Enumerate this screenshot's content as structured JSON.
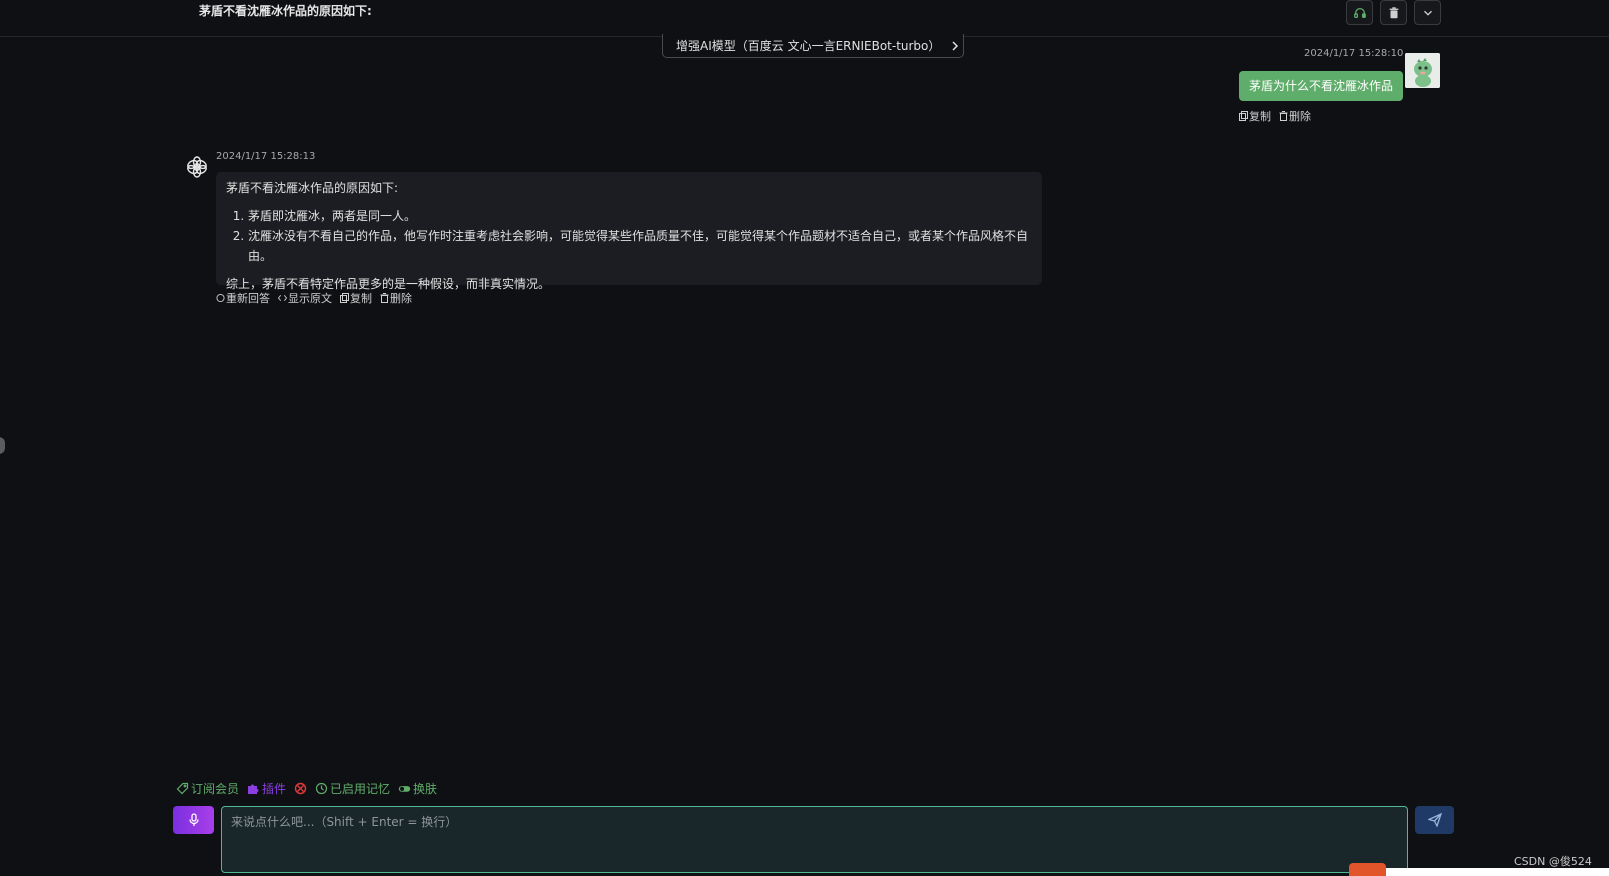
{
  "header": {
    "title": "茅盾不看沈雁冰作品的原因如下:",
    "buttons": [
      "headset-icon",
      "trash-icon",
      "chevron-down-icon"
    ]
  },
  "model": {
    "label": "增强AI模型（百度云 文心一言ERNIEBot-turbo）"
  },
  "user_message": {
    "time": "2024/1/17 15:28:10",
    "text": "茅盾为什么不看沈雁冰作品",
    "actions": {
      "copy": "复制",
      "delete": "删除"
    }
  },
  "bot_message": {
    "time": "2024/1/17 15:28:13",
    "intro": "茅盾不看沈雁冰作品的原因如下:",
    "items": [
      "茅盾即沈雁冰，两者是同一人。",
      "沈雁冰没有不看自己的作品，他写作时注重考虑社会影响，可能觉得某些作品质量不佳，可能觉得某个作品题材不适合自己，或者某个作品风格不自由。"
    ],
    "conclusion": "综上，茅盾不看特定作品更多的是一种假设，而非真实情况。",
    "actions": {
      "regenerate": "重新回答",
      "show_raw": "显示原文",
      "copy": "复制",
      "delete": "删除"
    }
  },
  "toolbar": {
    "subscribe": "订阅会员",
    "plugins": "插件",
    "memory": "已启用记忆",
    "skin": "换肤"
  },
  "input": {
    "placeholder": "来说点什么吧...（Shift + Enter = 换行）"
  },
  "watermark": "CSDN @俊524",
  "colors": {
    "accent_green": "#5fad6a",
    "input_border": "#4fb894",
    "plugin_purple": "#8b3fe0",
    "send_blue": "#1f3a66"
  }
}
